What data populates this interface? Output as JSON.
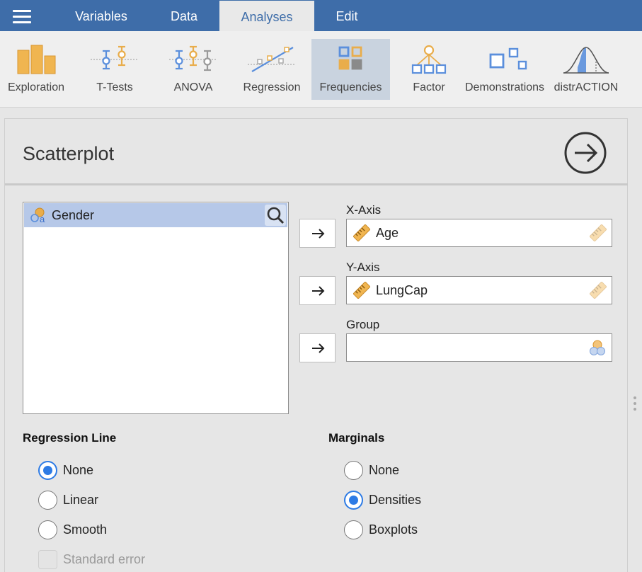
{
  "menu": {
    "tabs": [
      {
        "label": "Variables"
      },
      {
        "label": "Data"
      },
      {
        "label": "Analyses",
        "active": true
      },
      {
        "label": "Edit"
      }
    ]
  },
  "ribbon": {
    "buttons": [
      {
        "label": "Exploration",
        "icon": "exploration-bars-icon"
      },
      {
        "label": "T-Tests",
        "icon": "t-tests-icon"
      },
      {
        "label": "ANOVA",
        "icon": "anova-icon"
      },
      {
        "label": "Regression",
        "icon": "regression-icon"
      },
      {
        "label": "Frequencies",
        "icon": "frequencies-icon",
        "active": true
      },
      {
        "label": "Factor",
        "icon": "factor-tree-icon"
      },
      {
        "label": "Demonstrations",
        "icon": "demonstrations-icon"
      },
      {
        "label": "distrACTION",
        "icon": "distribution-curve-icon"
      }
    ]
  },
  "panel": {
    "title": "Scatterplot",
    "variables": [
      {
        "name": "Gender",
        "type": "nominal",
        "selected": true
      }
    ],
    "x_axis": {
      "label": "X-Axis",
      "value": "Age",
      "type": "continuous"
    },
    "y_axis": {
      "label": "Y-Axis",
      "value": "LungCap",
      "type": "continuous"
    },
    "group": {
      "label": "Group",
      "value": ""
    },
    "regression": {
      "label": "Regression Line",
      "options": [
        "None",
        "Linear",
        "Smooth"
      ],
      "selected": "None",
      "standard_error": {
        "label": "Standard error",
        "enabled": false,
        "checked": false
      }
    },
    "marginals": {
      "label": "Marginals",
      "options": [
        "None",
        "Densities",
        "Boxplots"
      ],
      "selected": "Densities"
    }
  },
  "colors": {
    "menubar": "#3e6da9",
    "accent_orange": "#e9ad4b",
    "accent_blue": "#5b8fdc",
    "radio_blue": "#2d7be5",
    "selected_row": "#b6c8e8"
  }
}
